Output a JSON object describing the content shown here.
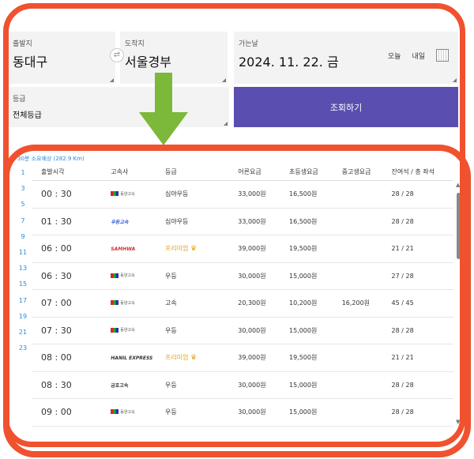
{
  "search": {
    "departure_label": "출발지",
    "departure_value": "동대구",
    "arrival_label": "도착지",
    "arrival_value": "서울경부",
    "date_label": "가는날",
    "date_value": "2024. 11. 22. 금",
    "today_label": "오늘",
    "tomorrow_label": "내일",
    "grade_label": "등급",
    "grade_value": "전체등급",
    "search_button": "조회하기"
  },
  "info_text": "30분 소요예상 (282.9 Km)",
  "pages": [
    "1",
    "3",
    "5",
    "7",
    "9",
    "11",
    "13",
    "15",
    "17",
    "19",
    "21",
    "23"
  ],
  "table": {
    "headers": [
      "출발시각",
      "고속사",
      "등급",
      "어른요금",
      "초등생요금",
      "중고생요금",
      "잔여석 / 총 좌석"
    ],
    "rows": [
      {
        "time": "00 : 30",
        "company": "동양고속",
        "grade": "심야우등",
        "adult": "33,000원",
        "kid": "16,500원",
        "mid": "",
        "seats": "28 / 28"
      },
      {
        "time": "01 : 30",
        "company": "우등고속",
        "grade": "심야우등",
        "adult": "33,000원",
        "kid": "16,500원",
        "mid": "",
        "seats": "28 / 28"
      },
      {
        "time": "06 : 00",
        "company": "SAMHWA",
        "grade": "프리미엄",
        "adult": "39,000원",
        "kid": "19,500원",
        "mid": "",
        "seats": "21 / 21",
        "premium": true
      },
      {
        "time": "06 : 30",
        "company": "동양고속",
        "grade": "우등",
        "adult": "30,000원",
        "kid": "15,000원",
        "mid": "",
        "seats": "27 / 28"
      },
      {
        "time": "07 : 00",
        "company": "동양고속",
        "grade": "고속",
        "adult": "20,300원",
        "kid": "10,200원",
        "mid": "16,200원",
        "seats": "45 / 45"
      },
      {
        "time": "07 : 30",
        "company": "동양고속",
        "grade": "우등",
        "adult": "30,000원",
        "kid": "15,000원",
        "mid": "",
        "seats": "28 / 28"
      },
      {
        "time": "08 : 00",
        "company": "HANIL EXPRESS",
        "grade": "프리미엄",
        "adult": "39,000원",
        "kid": "19,500원",
        "mid": "",
        "seats": "21 / 21",
        "premium": true
      },
      {
        "time": "08 : 30",
        "company": "금호고속",
        "grade": "우등",
        "adult": "30,000원",
        "kid": "15,000원",
        "mid": "",
        "seats": "28 / 28"
      },
      {
        "time": "09 : 00",
        "company": "동양고속",
        "grade": "우등",
        "adult": "30,000원",
        "kid": "15,000원",
        "mid": "",
        "seats": "28 / 28"
      }
    ]
  },
  "colors": {
    "accent": "#5a4fb0",
    "highlight": "#f0512f",
    "arrow": "#7cb83a",
    "premium": "#e4a71c"
  }
}
